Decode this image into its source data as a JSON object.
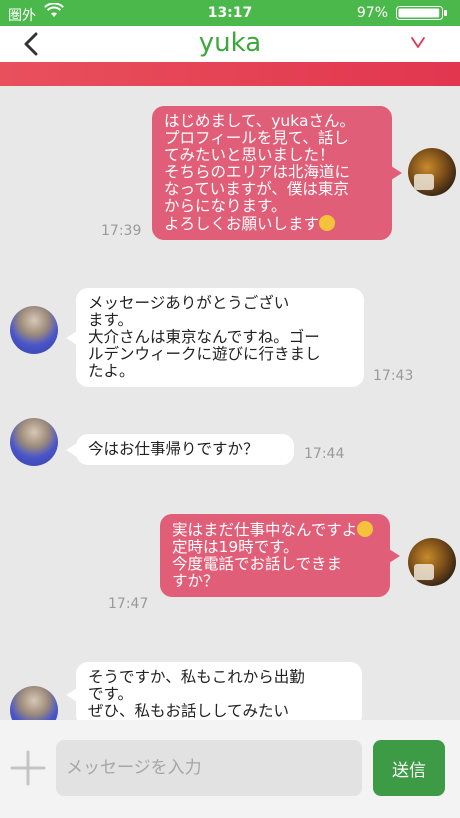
{
  "status_bar": {
    "carrier": "圏外",
    "time": "13:17",
    "battery_percent": "97%",
    "battery_level": 0.97
  },
  "header": {
    "title": "yuka",
    "back_icon": "chevron-left-icon",
    "menu_icon": "chevron-down-icon"
  },
  "colors": {
    "accent_green": "#4bb84b",
    "title_green": "#3aa83a",
    "outgoing_bubble": "#e15e78",
    "stripe": "#e2364f",
    "send_button": "#3d9b45"
  },
  "messages": [
    {
      "sender": "self",
      "text": "はじめまして、yukaさん。\nプロフィールを見て、話し\nてみたいと思いました！\nそちらのエリアは北海道に\nなっていますが、僕は東京\nからになります。\nよろしくお願いします",
      "emoji": "smiling-face-emoji",
      "time": "17:39"
    },
    {
      "sender": "yuka",
      "text": "メッセージありがとうござい\nます。\n大介さんは東京なんですね。ゴー\nルデンウィークに遊びに行きまし\nたよ。",
      "time": "17:43"
    },
    {
      "sender": "yuka",
      "text": "今はお仕事帰りですか？",
      "time": "17:44"
    },
    {
      "sender": "self",
      "text_before_emoji": "実はまだ仕事中なんですよ",
      "emoji": "sweat-smile-emoji",
      "text_after_emoji": "\n定時は19時です。\n今度電話でお話しできま\nすか？",
      "time": "17:47"
    },
    {
      "sender": "yuka",
      "text": "そうですか、私もこれから出勤\nです。\nぜひ、私もお話ししてみたい",
      "time": ""
    }
  ],
  "input": {
    "placeholder": "メッセージを入力",
    "value": "",
    "add_icon": "plus-icon",
    "send_label": "送信"
  }
}
